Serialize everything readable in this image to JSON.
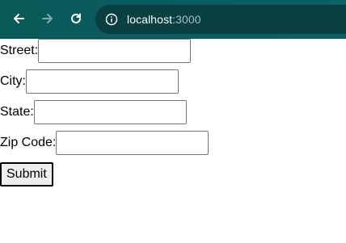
{
  "browser": {
    "url_host": "localhost",
    "url_port": ":3000"
  },
  "form": {
    "street_label": "Street:",
    "street_value": "",
    "city_label": "City:",
    "city_value": "",
    "state_label": "State:",
    "state_value": "",
    "zip_label": "Zip Code:",
    "zip_value": "",
    "submit_label": "Submit"
  }
}
